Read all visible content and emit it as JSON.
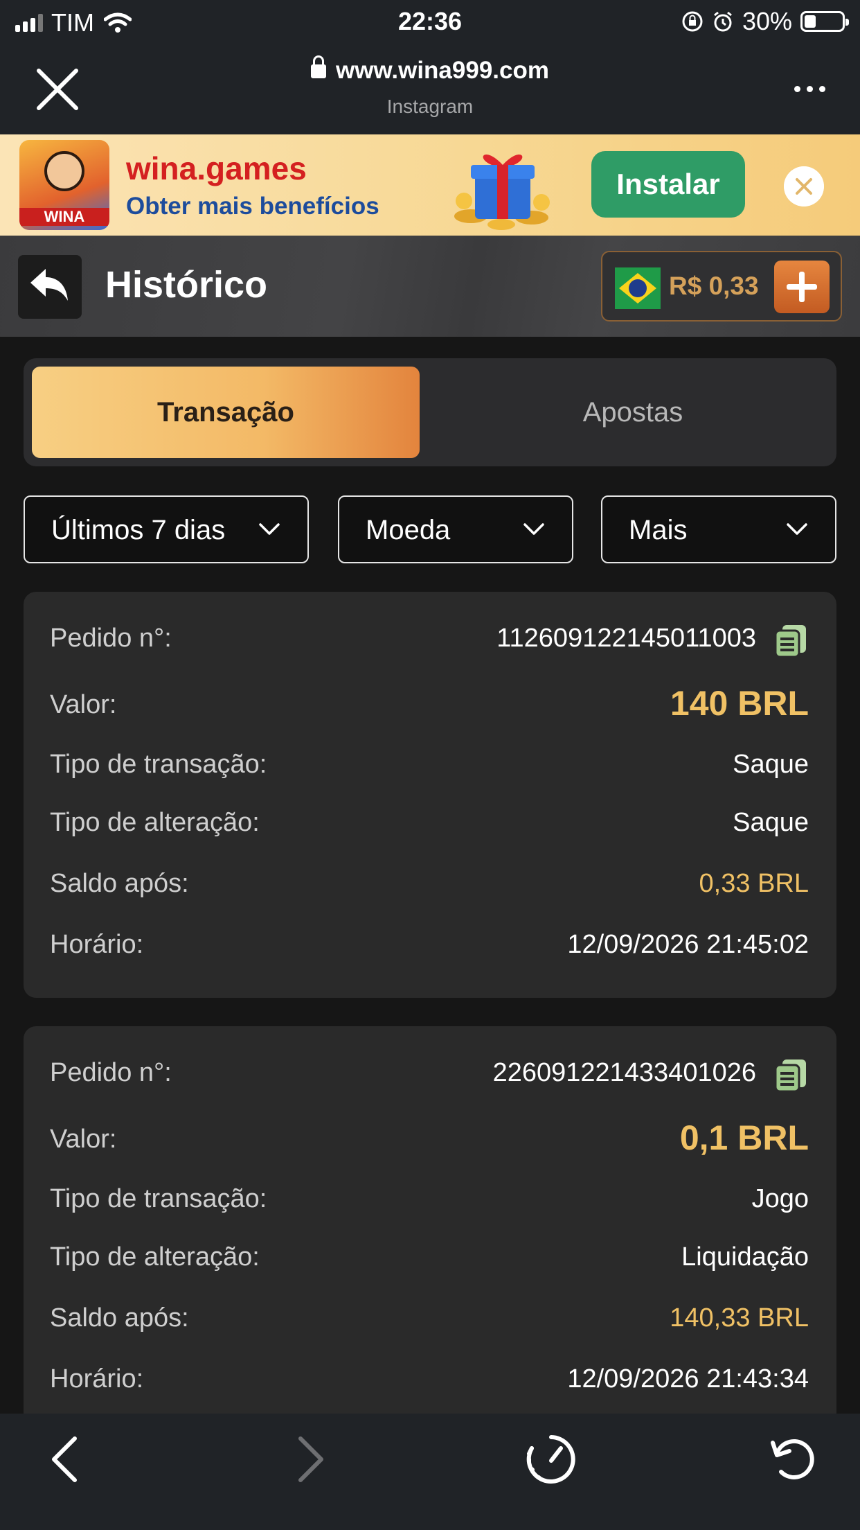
{
  "status_bar": {
    "carrier": "TIM",
    "time": "22:36",
    "battery": "30%",
    "battery_level": 0.3
  },
  "browser": {
    "url": "www.wina999.com",
    "source": "Instagram"
  },
  "ad_banner": {
    "logo_text": "WINA",
    "title": "wina.games",
    "subtitle": "Obter mais benefícios",
    "install_label": "Instalar"
  },
  "header": {
    "title": "Histórico",
    "balance": "R$ 0,33"
  },
  "tabs": [
    {
      "label": "Transação",
      "active": true
    },
    {
      "label": "Apostas",
      "active": false
    }
  ],
  "filters": [
    {
      "label": "Últimos 7 dias"
    },
    {
      "label": "Moeda"
    },
    {
      "label": "Mais"
    }
  ],
  "transactions": [
    {
      "order_label": "Pedido n°:",
      "order_no": "112609122145011003",
      "value_label": "Valor:",
      "value": "140 BRL",
      "tx_type_label": "Tipo de transação:",
      "tx_type": "Saque",
      "change_type_label": "Tipo de alteração:",
      "change_type": "Saque",
      "balance_label": "Saldo após:",
      "balance_after": "0,33 BRL",
      "time_label": "Horário:",
      "time": "12/09/2026 21:45:02"
    },
    {
      "order_label": "Pedido n°:",
      "order_no": "226091221433401026",
      "value_label": "Valor:",
      "value": "0,1 BRL",
      "tx_type_label": "Tipo de transação:",
      "tx_type": "Jogo",
      "change_type_label": "Tipo de alteração:",
      "change_type": "Liquidação",
      "balance_label": "Saldo após:",
      "balance_after": "140,33 BRL",
      "time_label": "Horário:",
      "time": "12/09/2026 21:43:34"
    }
  ],
  "colors": {
    "accent_gold": "#f0c165",
    "tab_gradient_start": "#f7cf83",
    "tab_gradient_end": "#e3843d",
    "install_green": "#2f9c66"
  },
  "icons": [
    "close-icon",
    "lock-icon",
    "more-icon",
    "back-arrow-icon",
    "plus-icon",
    "chevron-down-icon",
    "copy-icon",
    "nav-back-icon",
    "nav-forward-icon",
    "speed-icon",
    "reload-icon"
  ]
}
